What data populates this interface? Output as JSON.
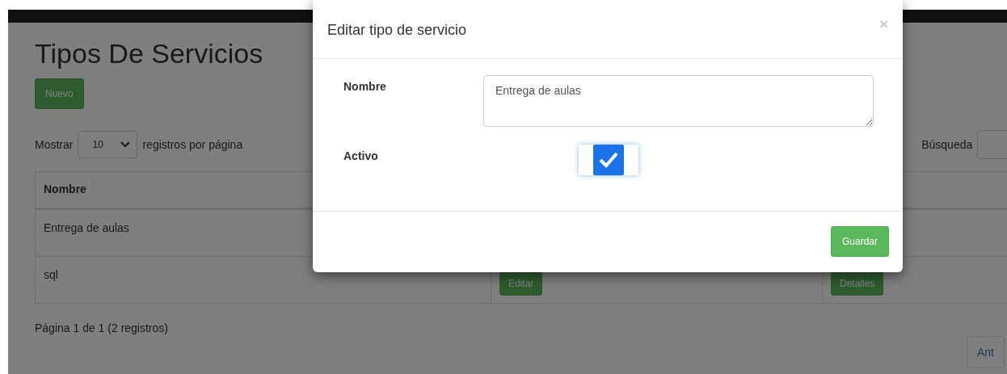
{
  "page": {
    "title": "Tipos De Servicios",
    "new_button": "Nuevo",
    "length": {
      "before": "Mostrar",
      "value": "10",
      "after": "registros por página"
    },
    "search_label": "Búsqueda",
    "table": {
      "columns": [
        "Nombre"
      ],
      "rows": [
        {
          "name": "Entrega de aulas",
          "actions": []
        },
        {
          "name": "sql",
          "actions": [
            "Editar",
            "Detalles"
          ]
        }
      ]
    },
    "info": "Página 1 de 1 (2 registros)",
    "pager": [
      "Ant"
    ]
  },
  "modal": {
    "title": "Editar tipo de servicio",
    "close": "×",
    "fields": [
      {
        "kind": "textarea",
        "label": "Nombre",
        "value": "Entrega de aulas"
      },
      {
        "kind": "checkbox",
        "label": "Activo",
        "checked": true
      }
    ],
    "save_button": "Guardar"
  }
}
